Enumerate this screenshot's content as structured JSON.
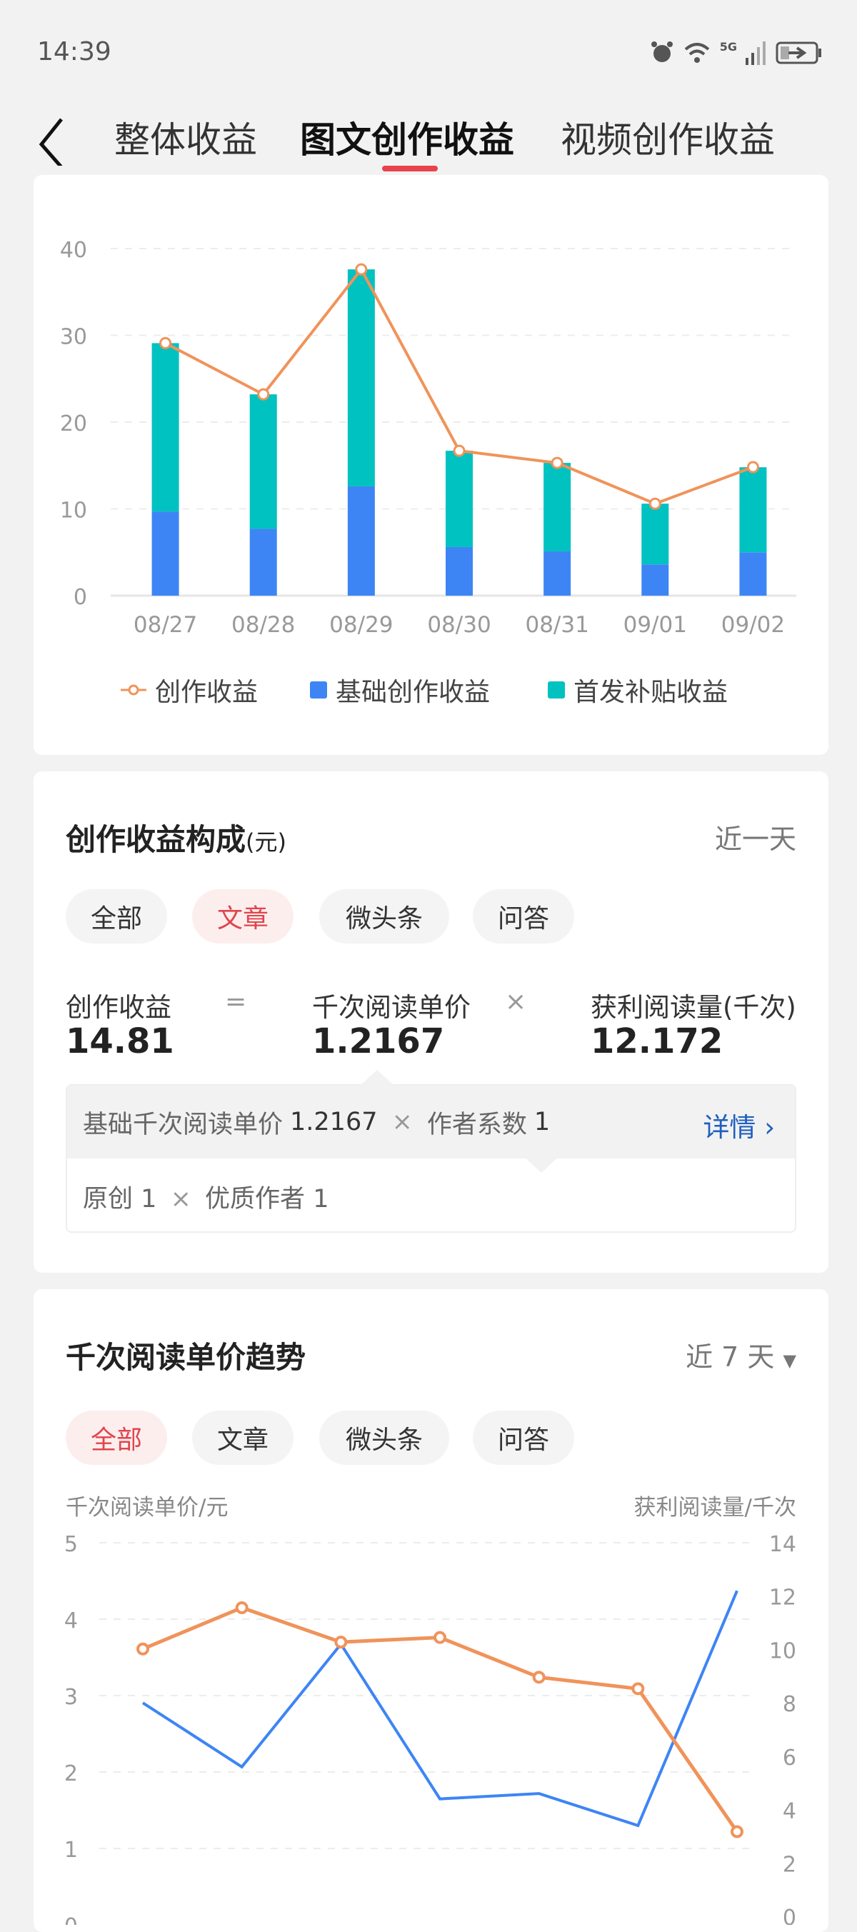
{
  "status_bar": {
    "time": "14:39",
    "network": "5G",
    "icons": [
      "alarm-icon",
      "wifi-icon",
      "signal-icon",
      "battery-charging-icon"
    ]
  },
  "header": {
    "tabs": [
      {
        "label": "整体收益"
      },
      {
        "label": "图文创作收益",
        "active": true
      },
      {
        "label": "视频创作收益"
      }
    ]
  },
  "colors": {
    "accent": "#e8424a",
    "line": "#f0935a",
    "base": "#3d85f5",
    "subsidy": "#00c2c0",
    "link": "#1f5fbf"
  },
  "chart_data": [
    {
      "type": "bar",
      "stacked": true,
      "categories": [
        "08/27",
        "08/28",
        "08/29",
        "08/30",
        "08/31",
        "09/01",
        "09/02"
      ],
      "ylim": [
        0,
        40
      ],
      "yticks": [
        0,
        10,
        20,
        30,
        40
      ],
      "grid": true,
      "legend_position": "bottom",
      "series": [
        {
          "name": "创作收益",
          "kind": "line",
          "values": [
            29.1,
            23.2,
            37.6,
            16.7,
            15.3,
            10.6,
            14.81
          ]
        },
        {
          "name": "基础创作收益",
          "kind": "bar",
          "values": [
            9.7,
            7.7,
            12.6,
            5.6,
            5.1,
            3.6,
            5.0
          ]
        },
        {
          "name": "首发补贴收益",
          "kind": "bar",
          "values": [
            19.4,
            15.5,
            25.0,
            11.1,
            10.2,
            7.0,
            9.8
          ]
        }
      ]
    },
    {
      "type": "line",
      "ylabel": "千次阅读单价/元",
      "ylabel_right": "获利阅读量/千次",
      "ylim": [
        0,
        5
      ],
      "yticks": [
        0,
        1,
        2,
        3,
        4,
        5
      ],
      "ylim_right": [
        0,
        14
      ],
      "yticks_right": [
        0,
        2,
        4,
        6,
        8,
        10,
        12,
        14
      ],
      "grid": true,
      "series": [
        {
          "axis": "left",
          "color": "#f0935a",
          "values": [
            3.61,
            4.15,
            3.7,
            3.76,
            3.24,
            3.09,
            1.22
          ]
        },
        {
          "axis": "right",
          "color": "#3d85f5",
          "values": [
            8.0,
            5.6,
            10.2,
            4.4,
            4.6,
            3.4,
            12.2
          ]
        }
      ]
    }
  ],
  "composition": {
    "title": "创作收益构成",
    "unit": "(元)",
    "range": "近一天",
    "chips": [
      {
        "label": "全部"
      },
      {
        "label": "文章",
        "active": true
      },
      {
        "label": "微头条"
      },
      {
        "label": "问答"
      }
    ],
    "formula": {
      "income_label": "创作收益",
      "income_value": "14.81",
      "equals": "=",
      "price_label": "千次阅读单价",
      "price_value": "1.2167",
      "times": "×",
      "reads_label": "获利阅读量(千次)",
      "reads_value": "12.172"
    },
    "detail": {
      "base_label": "基础千次阅读单价",
      "base_value": "1.2167",
      "times": "×",
      "coef_label": "作者系数",
      "coef_value": "1",
      "link": "详情",
      "original_label": "原创",
      "original_value": "1",
      "quality_label": "优质作者",
      "quality_value": "1"
    }
  },
  "trend": {
    "title": "千次阅读单价趋势",
    "range": "近 7 天",
    "chips": [
      {
        "label": "全部",
        "active": true
      },
      {
        "label": "文章"
      },
      {
        "label": "微头条"
      },
      {
        "label": "问答"
      }
    ]
  }
}
